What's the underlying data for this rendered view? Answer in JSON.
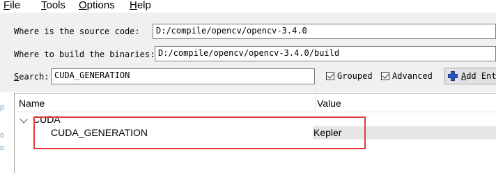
{
  "menubar": {
    "items": [
      {
        "mnemonic": "F",
        "rest": "ile"
      },
      {
        "mnemonic": "T",
        "rest": "ools"
      },
      {
        "mnemonic": "O",
        "rest": "ptions"
      },
      {
        "mnemonic": "H",
        "rest": "elp"
      }
    ]
  },
  "form": {
    "source_label": "Where is the source code:",
    "source_value": "D:/compile/opencv/opencv-3.4.0",
    "build_label": "Where to build the binaries:",
    "build_value": "D:/compile/opencv/opencv-3.4.0/build",
    "search_label_mnemonic": "S",
    "search_label_rest": "earch:",
    "search_value": "CUDA_GENERATION",
    "grouped_label": "Grouped",
    "grouped_checked": true,
    "advanced_label": "Advanced",
    "advanced_checked": true,
    "add_entry_mnemonic": "A",
    "add_entry_rest": "dd Entry"
  },
  "tree": {
    "col_name": "Name",
    "col_value": "Value",
    "group_label": "CUDA",
    "entry_name": "CUDA_GENERATION",
    "entry_value": "Kepler"
  },
  "left_edge": [
    "p",
    "o",
    "o"
  ],
  "colors": {
    "highlight_box": "#e23a3a",
    "accent": "#2b55c6"
  }
}
